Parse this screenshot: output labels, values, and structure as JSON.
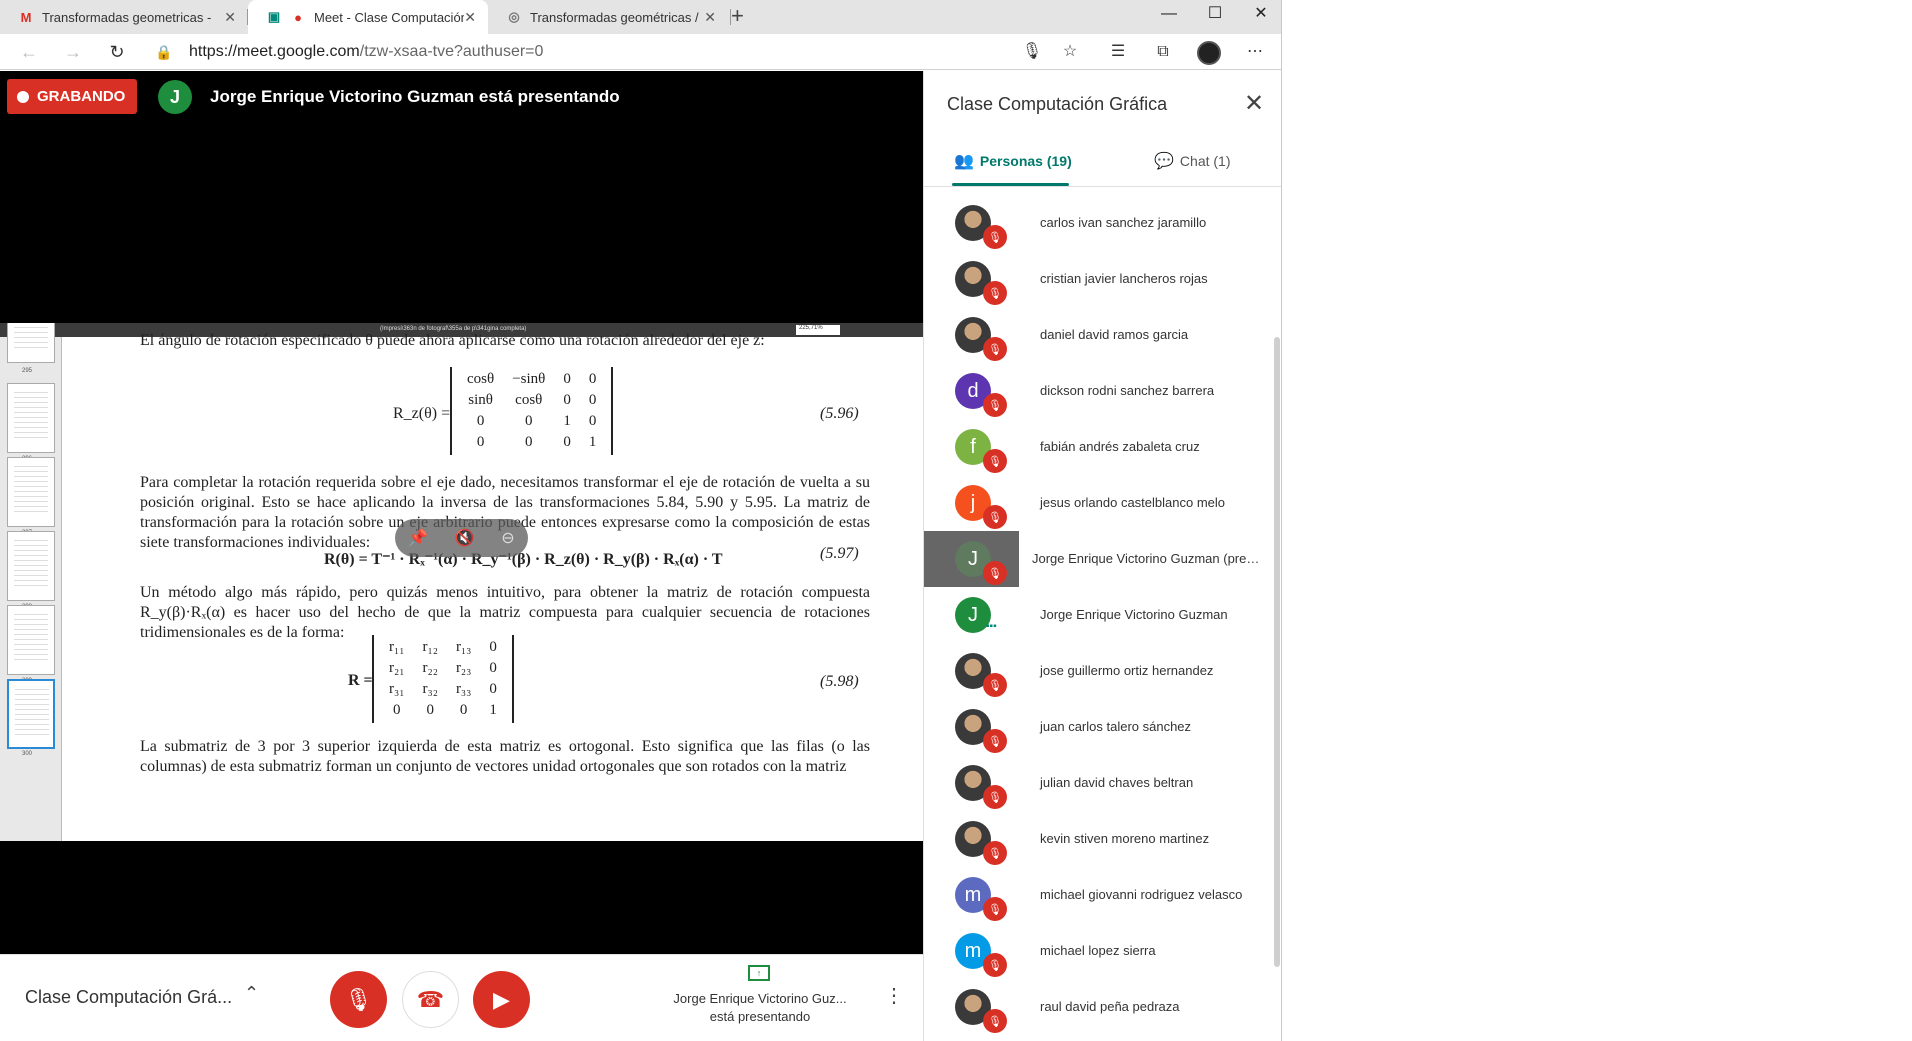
{
  "browser": {
    "tabs": [
      {
        "title": "Transformadas geometricas - jpa",
        "favicon": "gmail-icon",
        "active": false
      },
      {
        "title": "Meet - Clase Computación G",
        "favicon": "meet-icon",
        "active": true
      },
      {
        "title": "Transformadas geométricas / jos",
        "favicon": "site-icon",
        "active": false
      }
    ],
    "new_tab_symbol": "+",
    "window_controls": {
      "minimize": "—",
      "maximize": "☐",
      "close": "✕"
    },
    "url_host": "https://meet.google.com",
    "url_path": "/tzw-xsaa-tve?authuser=0"
  },
  "meet": {
    "recording_label": "GRABANDO",
    "presenter_initial": "J",
    "presenter_banner": "Jorge Enrique Victorino Guzman está presentando",
    "shared_document": {
      "toolbar_title": "(Impresi\\363n de fotograf\\355a de p\\341gina completa)",
      "page_input": "300",
      "zoom": "225,71%",
      "thumbnail_pages": [
        "295",
        "296",
        "297",
        "298",
        "299",
        "300"
      ],
      "line_top": "El ángulo de rotación especificado θ puede ahora aplicarse como una rotación alrededor del eje z:",
      "eq_596_label": "R_z(θ) =",
      "eq_596_matrix": [
        [
          "cosθ",
          "−sinθ",
          "0",
          "0"
        ],
        [
          "sinθ",
          "cosθ",
          "0",
          "0"
        ],
        [
          "0",
          "0",
          "1",
          "0"
        ],
        [
          "0",
          "0",
          "0",
          "1"
        ]
      ],
      "eq_596_number": "(5.96)",
      "paragraph_1": "Para completar la rotación requerida sobre el eje dado, necesitamos transformar el eje de rotación de vuelta a su posición original. Esto se hace aplicando la inversa de las transformaciones 5.84, 5.90 y 5.95. La matriz de transformación para la rotación sobre un eje arbitrario puede entonces expresarse como la composición de estas siete transformaciones individuales:",
      "eq_597": "R(θ) = T⁻¹ · Rₓ⁻¹(α) · R_y⁻¹(β) · R_z(θ) · R_y(β) · Rₓ(α) · T",
      "eq_597_number": "(5.97)",
      "paragraph_2": "Un método algo más rápido, pero quizás menos intuitivo, para obtener la matriz de rotación compuesta R_y(β)·Rₓ(α) es hacer uso del hecho de que la matriz compuesta para cualquier secuencia de rotaciones tridimensionales es de la forma:",
      "eq_598_label": "R =",
      "eq_598_matrix": [
        [
          "r₁₁",
          "r₁₂",
          "r₁₃",
          "0"
        ],
        [
          "r₂₁",
          "r₂₂",
          "r₂₃",
          "0"
        ],
        [
          "r₃₁",
          "r₃₂",
          "r₃₃",
          "0"
        ],
        [
          "0",
          "0",
          "0",
          "1"
        ]
      ],
      "eq_598_number": "(5.98)",
      "paragraph_3": "La submatriz de 3 por 3 superior izquierda de esta matriz es ortogonal. Esto significa que las filas (o las columnas) de esta submatriz forman un conjunto de vectores unidad ortogonales que son rotados con la matriz"
    },
    "overlay_icons": [
      "pin-icon",
      "mute-all-icon",
      "remove-icon"
    ],
    "controls": {
      "meeting_title": "Clase Computación Grá...",
      "present_line1": "Jorge Enrique Victorino Guz...",
      "present_line2": "está presentando"
    }
  },
  "panel": {
    "title": "Clase Computación Gráfica",
    "tabs": {
      "people": "Personas (19)",
      "chat": "Chat (1)"
    },
    "people": [
      {
        "name": "carlos ivan sanchez jaramillo",
        "initial": "",
        "color": "",
        "photo": true,
        "state": "muted"
      },
      {
        "name": "cristian javier lancheros rojas",
        "initial": "",
        "color": "",
        "photo": true,
        "state": "muted"
      },
      {
        "name": "daniel david ramos garcia",
        "initial": "",
        "color": "",
        "photo": true,
        "state": "muted"
      },
      {
        "name": "dickson rodni sanchez barrera",
        "initial": "d",
        "color": "#5e35b1",
        "photo": false,
        "state": "muted"
      },
      {
        "name": "fabián andrés zabaleta cruz",
        "initial": "f",
        "color": "#7cb342",
        "photo": false,
        "state": "muted"
      },
      {
        "name": "jesus orlando castelblanco melo",
        "initial": "j",
        "color": "#f4511e",
        "photo": false,
        "state": "muted"
      },
      {
        "name": "Jorge Enrique Victorino Guzman (pres...",
        "initial": "J",
        "color": "#5f7a5f",
        "photo": false,
        "state": "muted",
        "highlight": true
      },
      {
        "name": "Jorge Enrique Victorino Guzman",
        "initial": "J",
        "color": "#1e8e3e",
        "photo": false,
        "state": "speaking"
      },
      {
        "name": "jose guillermo ortiz hernandez",
        "initial": "",
        "color": "",
        "photo": true,
        "state": "muted"
      },
      {
        "name": "juan carlos talero sánchez",
        "initial": "",
        "color": "",
        "photo": true,
        "state": "muted"
      },
      {
        "name": "julian david chaves beltran",
        "initial": "",
        "color": "",
        "photo": true,
        "state": "muted"
      },
      {
        "name": "kevin stiven moreno martinez",
        "initial": "",
        "color": "",
        "photo": true,
        "state": "muted"
      },
      {
        "name": "michael giovanni rodriguez velasco",
        "initial": "m",
        "color": "#5c6bc0",
        "photo": false,
        "state": "muted"
      },
      {
        "name": "michael lopez sierra",
        "initial": "m",
        "color": "#039be5",
        "photo": false,
        "state": "muted"
      },
      {
        "name": "raul david peña pedraza",
        "initial": "",
        "color": "",
        "photo": true,
        "state": "muted"
      }
    ]
  }
}
